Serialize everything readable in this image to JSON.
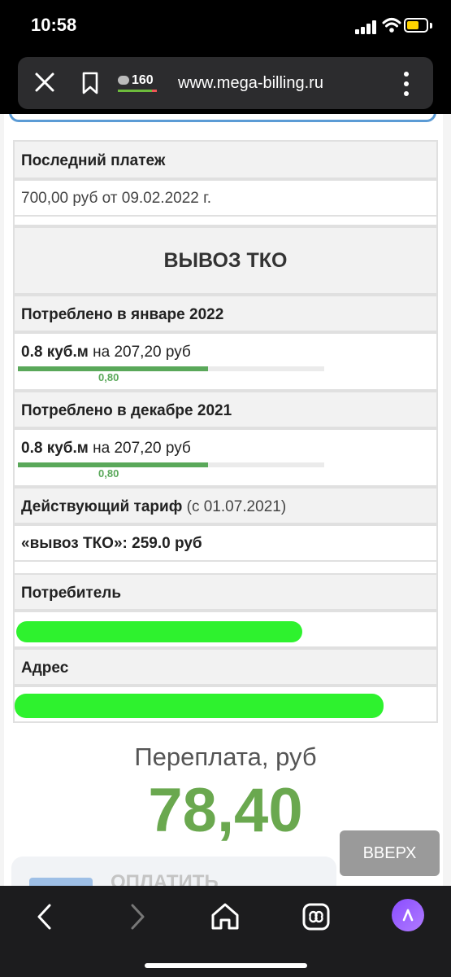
{
  "status_bar": {
    "time": "10:58"
  },
  "browser": {
    "url": "www.mega-billing.ru",
    "comments_count": "160"
  },
  "last_payment": {
    "title": "Последний платеж",
    "value": "700,00 руб от 09.02.2022 г."
  },
  "section": {
    "title": "ВЫВОЗ ТКО"
  },
  "consumption": [
    {
      "title": "Потреблено в январе 2022",
      "amount": "0.8 куб.м",
      "cost": "на 207,20 руб",
      "bar_label": "0,80",
      "fill_fraction": 0.62
    },
    {
      "title": "Потреблено в декабре 2021",
      "amount": "0.8 куб.м",
      "cost": "на 207,20 руб",
      "bar_label": "0,80",
      "fill_fraction": 0.62
    }
  ],
  "tariff": {
    "title": "Действующий тариф",
    "since": "(с 01.07.2021)",
    "name": "«вывоз ТКО»:",
    "price": "259.0 руб"
  },
  "consumer": {
    "title": "Потребитель"
  },
  "address": {
    "title": "Адрес"
  },
  "overpayment": {
    "label": "Переплата, руб",
    "value": "78,40"
  },
  "buttons": {
    "up": "ВВЕРХ",
    "pay": "ОПЛАТИТЬ"
  },
  "colors": {
    "accent_green": "#6aa84f",
    "redaction_green": "#2ef22e",
    "progress_green": "#5aa85a"
  }
}
